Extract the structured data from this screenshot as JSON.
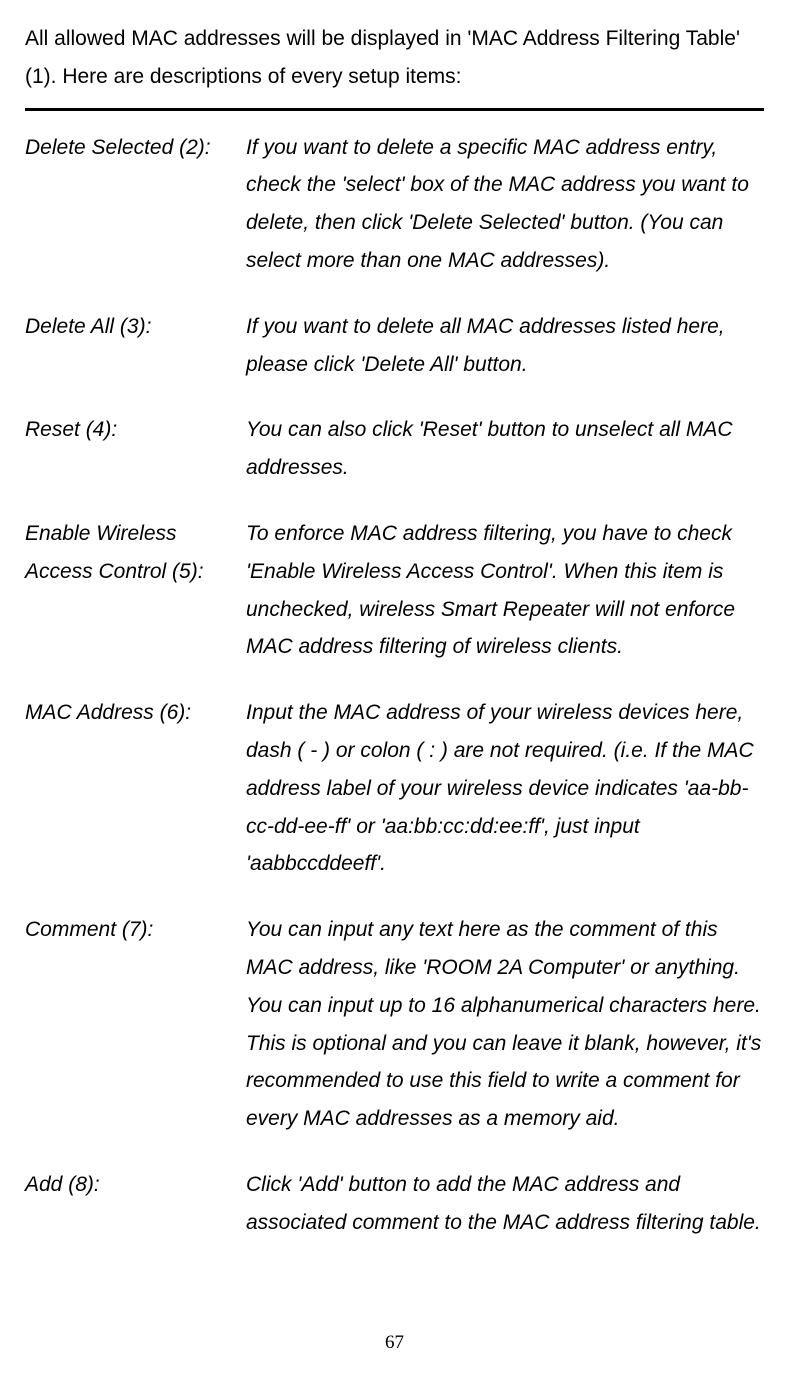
{
  "intro": "All allowed MAC addresses will be displayed in 'MAC Address Filtering Table' (1). Here are descriptions of every setup items:",
  "items": [
    {
      "label": "Delete Selected (2):",
      "desc": "If you want to delete a specific MAC address entry, check the 'select' box of the MAC address you want to delete, then click 'Delete Selected' button. (You can select more than one MAC addresses)."
    },
    {
      "label": "Delete All (3):",
      "desc": "If you want to delete all MAC addresses listed here, please click 'Delete All' button."
    },
    {
      "label": "Reset (4):",
      "desc": "You can also click 'Reset' button to unselect all MAC addresses."
    },
    {
      "label": "Enable Wireless Access Control (5):",
      "desc": "To enforce MAC address filtering, you have to check 'Enable Wireless Access Control'. When this item is unchecked, wireless Smart Repeater will not enforce MAC address filtering of wireless clients."
    },
    {
      "label": "MAC Address (6):",
      "desc": "Input the MAC address of your wireless devices here, dash ( - ) or colon ( : ) are not required. (i.e. If the MAC address label of your wireless device indicates 'aa-bb-cc-dd-ee-ff' or 'aa:bb:cc:dd:ee:ff', just input 'aabbccddeeff'."
    },
    {
      "label": "Comment (7):",
      "desc": "You can input any text here as the comment of this MAC address, like 'ROOM 2A Computer' or anything. You can input up to 16 alphanumerical characters here. This is optional and you can leave it blank, however, it's recommended to use this field to write a comment for every MAC addresses as a memory aid."
    },
    {
      "label": "Add (8):",
      "desc": "Click 'Add' button to add the MAC address and associated comment to the MAC address filtering table."
    }
  ],
  "page_number": "67"
}
